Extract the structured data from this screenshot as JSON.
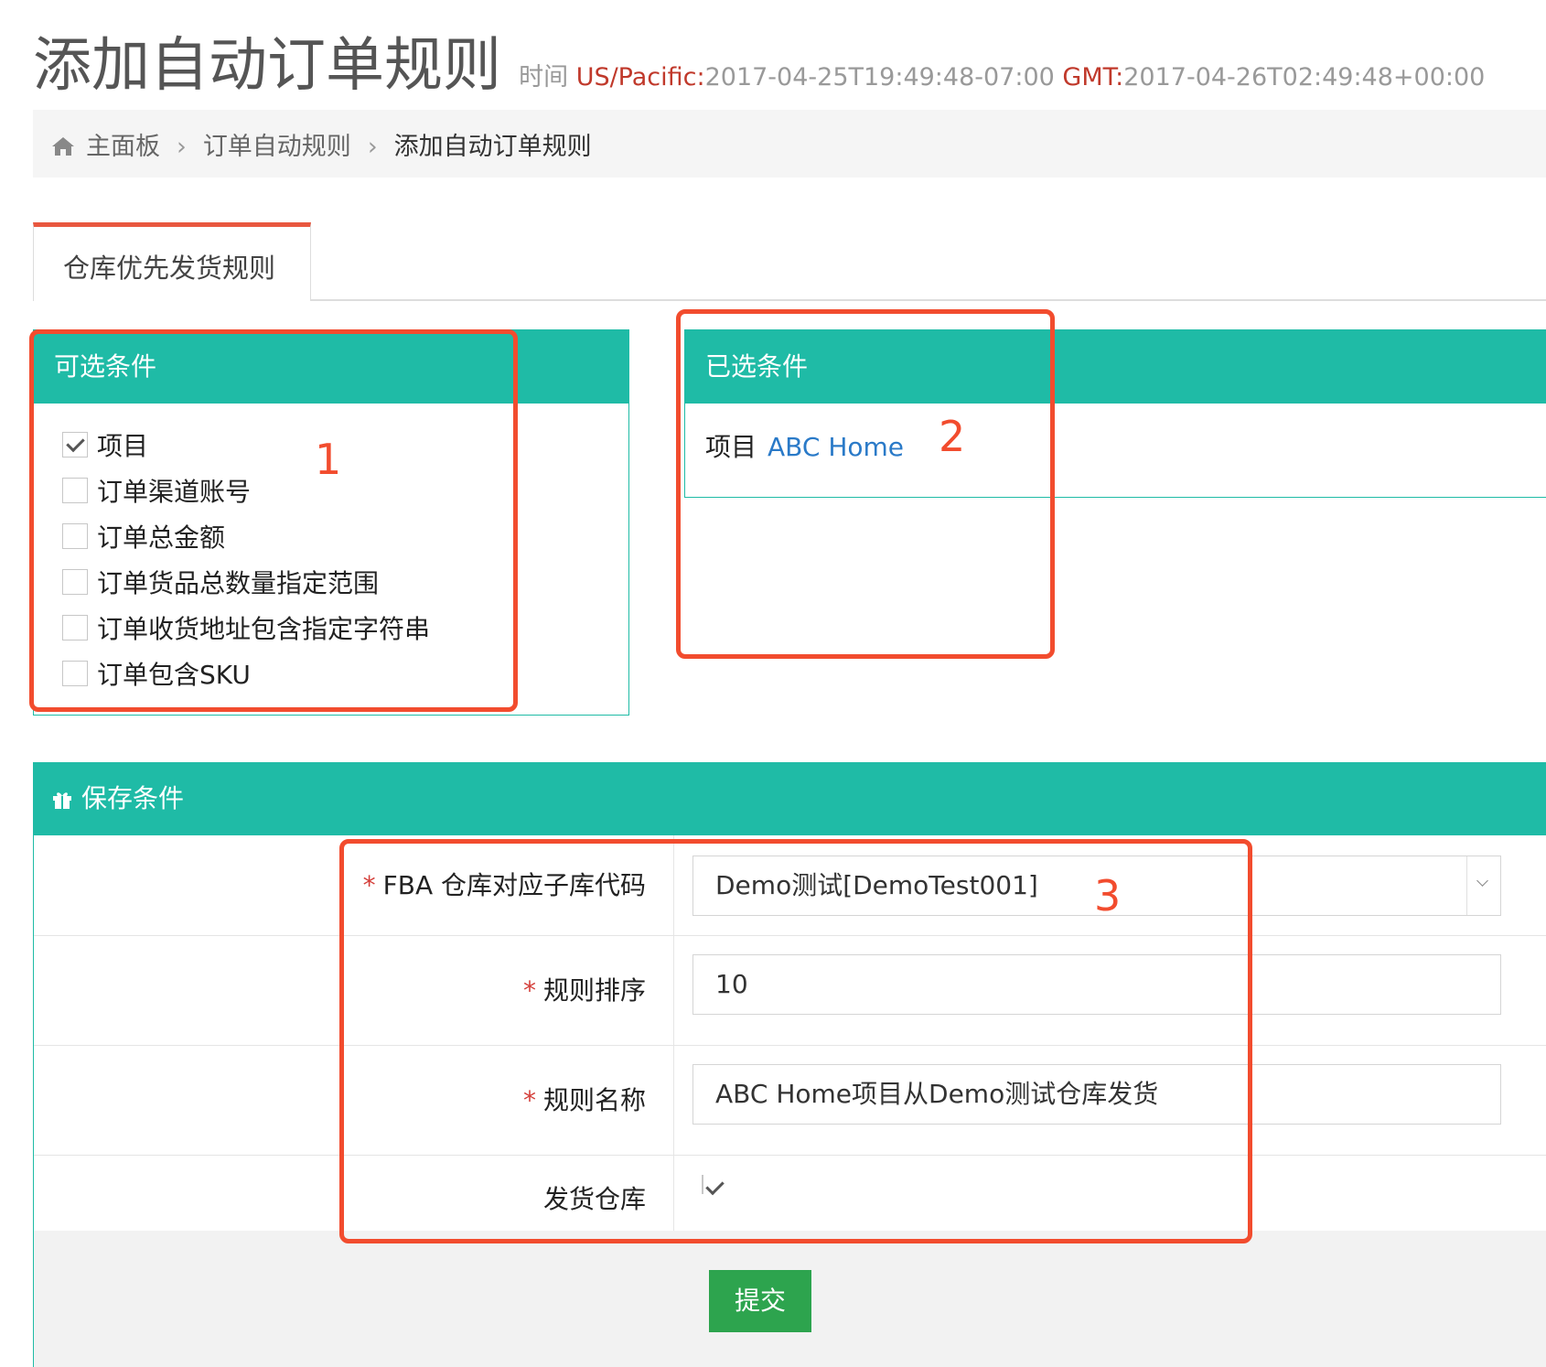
{
  "page": {
    "title": "添加自动订单规则",
    "time_label": "时间",
    "tz_local_label": "US/Pacific:",
    "tz_local_value": "2017-04-25T19:49:48-07:00",
    "tz_gmt_label": "GMT:",
    "tz_gmt_value": "2017-04-26T02:49:48+00:00"
  },
  "breadcrumb": {
    "items": [
      "主面板",
      "订单自动规则",
      "添加自动订单规则"
    ]
  },
  "tabs": [
    {
      "label": "仓库优先发货规则",
      "active": true
    }
  ],
  "available_conditions": {
    "title": "可选条件",
    "items": [
      {
        "label": "项目",
        "checked": true
      },
      {
        "label": "订单渠道账号",
        "checked": false
      },
      {
        "label": "订单总金额",
        "checked": false
      },
      {
        "label": "订单货品总数量指定范围",
        "checked": false
      },
      {
        "label": "订单收货地址包含指定字符串",
        "checked": false
      },
      {
        "label": "订单包含SKU",
        "checked": false
      }
    ]
  },
  "selected_conditions": {
    "title": "已选条件",
    "rows": [
      {
        "label": "项目",
        "value": "ABC Home"
      }
    ]
  },
  "save": {
    "title": "保存条件",
    "fields": [
      {
        "label": "FBA 仓库对应子库代码",
        "required": true,
        "type": "select",
        "value": "Demo测试[DemoTest001]"
      },
      {
        "label": "规则排序",
        "required": true,
        "type": "text",
        "value": "10"
      },
      {
        "label": "规则名称",
        "required": true,
        "type": "text",
        "value": "ABC Home项目从Demo测试仓库发货"
      },
      {
        "label": "发货仓库",
        "required": false,
        "type": "checkbox",
        "checked": true
      }
    ],
    "required_mark": "*",
    "submit_label": "提交"
  },
  "annotations": [
    "1",
    "2",
    "3"
  ],
  "colors": {
    "teal": "#1fbba6",
    "annotation_red": "#f24c2e",
    "submit_green": "#2da44e",
    "tab_accent": "#e9573f",
    "link_blue": "#2a7ac8"
  }
}
